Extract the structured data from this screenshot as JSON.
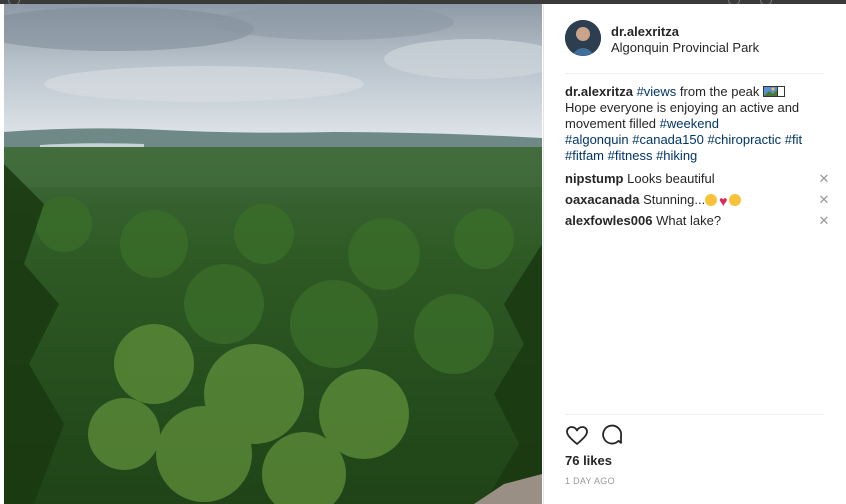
{
  "post": {
    "username": "dr.alexritza",
    "location": "Algonquin Provincial Park",
    "caption": {
      "author": "dr.alexritza",
      "tag_views": "#views",
      "text_1": " from the peak ",
      "text_2": "Hope everyone is enjoying an active and movement filled ",
      "tag_weekend": "#weekend",
      "tags_line": [
        "#algonquin",
        "#canada150",
        "#chiropractic",
        "#fit",
        "#fitfam",
        "#fitness",
        "#hiking"
      ]
    },
    "comments": [
      {
        "user": "nipstump",
        "text": "Looks beautiful"
      },
      {
        "user": "oaxacanada",
        "text": "Stunning..."
      },
      {
        "user": "alexfowles006",
        "text": "What lake?"
      }
    ],
    "likes": "76 likes",
    "time": "1 DAY AGO"
  },
  "icons": {
    "like": "heart-icon",
    "comment": "comment-icon",
    "remove": "close-icon"
  },
  "colors": {
    "hashtag": "#003569",
    "text": "#262626",
    "muted": "#999999"
  }
}
